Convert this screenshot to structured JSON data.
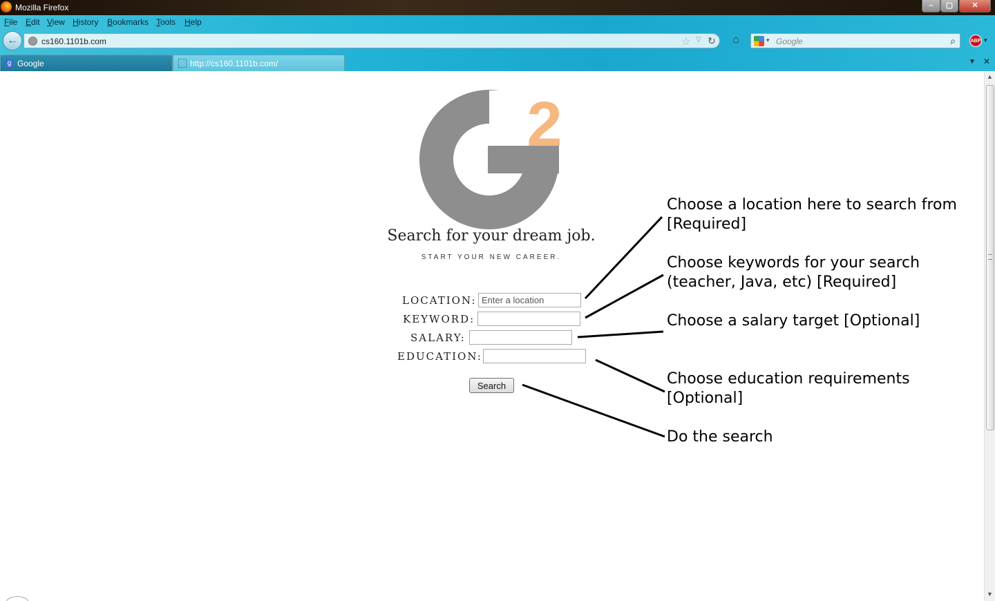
{
  "window": {
    "title": "Mozilla Firefox"
  },
  "menu": [
    "File",
    "Edit",
    "View",
    "History",
    "Bookmarks",
    "Tools",
    "Help"
  ],
  "navigation": {
    "url": "cs160.1101b.com",
    "search_placeholder": "Google"
  },
  "tabs": [
    {
      "label": "Google"
    },
    {
      "label": "http://cs160.1101b.com/"
    }
  ],
  "page": {
    "logo_superscript": "2",
    "tagline": "Search for your dream job.",
    "subtagline": "START YOUR NEW CAREER.",
    "form": {
      "location_label": "LOCATION:",
      "location_placeholder": "Enter a location",
      "keyword_label": "KEYWORD:",
      "salary_label": "SALARY:",
      "education_label": "EDUCATION:",
      "search_button": "Search"
    }
  },
  "annotations": {
    "location": "Choose a location here to search from [Required]",
    "keyword": "Choose keywords for your search (teacher, Java, etc) [Required]",
    "salary": "Choose a salary target [Optional]",
    "education": "Choose education requirements [Optional]",
    "search": "Do the search"
  },
  "colors": {
    "logo_gray": "#8e8e8e",
    "logo_accent": "#f5b880",
    "chrome_accent": "#22b3d6"
  },
  "icons": [
    "firefox-logo-icon",
    "back-arrow-icon",
    "globe-icon",
    "bookmark-star-icon",
    "reload-icon",
    "home-icon",
    "google-icon",
    "magnifier-icon",
    "adblock-icon"
  ]
}
